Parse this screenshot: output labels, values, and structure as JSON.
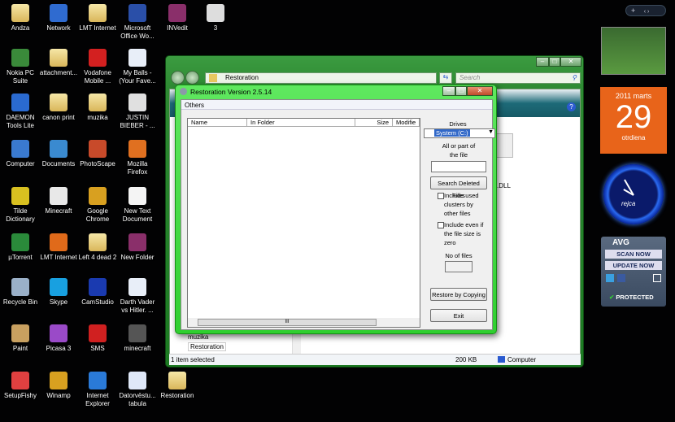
{
  "desktop": {
    "icons": [
      {
        "label": "Andza",
        "icon": "folder-icon",
        "color": "folder"
      },
      {
        "label": "Network",
        "icon": "network-icon",
        "color": "#2f6bd0"
      },
      {
        "label": "LMT Internet",
        "icon": "folder-icon",
        "color": "folder"
      },
      {
        "label": "Microsoft Office Wo...",
        "icon": "word-icon",
        "color": "#2a4fa8"
      },
      {
        "label": "INVedit",
        "icon": "winrar-icon",
        "color": "#8a2f6a"
      },
      {
        "label": "3",
        "icon": "calendar-icon",
        "color": "#dddddd"
      },
      {
        "label": "Nokia PC Suite",
        "icon": "nokia-icon",
        "color": "#3a8a3a"
      },
      {
        "label": "attachment...",
        "icon": "folder-icon",
        "color": "folder"
      },
      {
        "label": "Vodafone Mobile ...",
        "icon": "vodafone-icon",
        "color": "#d32020"
      },
      {
        "label": "My Balls - (Your Fave...",
        "icon": "audio-file-icon",
        "color": "#e8eef8"
      },
      {
        "label": "DAEMON Tools Lite",
        "icon": "daemon-icon",
        "color": "#2a6ad0"
      },
      {
        "label": "canon print",
        "icon": "folder-icon",
        "color": "folder"
      },
      {
        "label": "muzika",
        "icon": "folder-icon",
        "color": "folder"
      },
      {
        "label": "JUSTIN BIEBER - ...",
        "icon": "video-file-icon",
        "color": "#e0e0e0"
      },
      {
        "label": "Computer",
        "icon": "computer-icon",
        "color": "#3a7ad0"
      },
      {
        "label": "Documents",
        "icon": "documents-icon",
        "color": "#3a8ad0"
      },
      {
        "label": "PhotoScape",
        "icon": "photoscape-icon",
        "color": "#c84a2a"
      },
      {
        "label": "Mozilla Firefox",
        "icon": "firefox-icon",
        "color": "#e07020"
      },
      {
        "label": "Tilde Dictionary",
        "icon": "tilde-icon",
        "color": "#d8c020"
      },
      {
        "label": "Minecraft",
        "icon": "file-icon",
        "color": "#e8e8e8"
      },
      {
        "label": "Google Chrome",
        "icon": "chrome-icon",
        "color": "#d8a020"
      },
      {
        "label": "New Text Document",
        "icon": "text-file-icon",
        "color": "#f4f4f4"
      },
      {
        "label": "µTorrent",
        "icon": "utorrent-icon",
        "color": "#2a8a3a"
      },
      {
        "label": "LMT Internet",
        "icon": "lmt-icon",
        "color": "#e06a1a"
      },
      {
        "label": "Left 4 dead 2",
        "icon": "folder-icon",
        "color": "folder"
      },
      {
        "label": "New Folder",
        "icon": "winrar-icon",
        "color": "#8a2f6a"
      },
      {
        "label": "Recycle Bin",
        "icon": "recycle-bin-icon",
        "color": "#9ab0c8"
      },
      {
        "label": "Skype",
        "icon": "skype-icon",
        "color": "#18a0e0"
      },
      {
        "label": "CamStudio",
        "icon": "camstudio-icon",
        "color": "#1a3ab0"
      },
      {
        "label": "Darth Vader vs Hitler. ...",
        "icon": "audio-file-icon",
        "color": "#e8eef8"
      },
      {
        "label": "Paint",
        "icon": "paint-icon",
        "color": "#c8a060"
      },
      {
        "label": "Picasa 3",
        "icon": "picasa-icon",
        "color": "#9a4ac8"
      },
      {
        "label": "SMS",
        "icon": "sms-icon",
        "color": "#d02020"
      },
      {
        "label": "minecraft",
        "icon": "chip-icon",
        "color": "#555555"
      },
      {
        "label": "SetupFishy",
        "icon": "fish-icon",
        "color": "#e04040"
      },
      {
        "label": "Winamp",
        "icon": "winamp-icon",
        "color": "#d8a020"
      },
      {
        "label": "Internet Explorer",
        "icon": "ie-icon",
        "color": "#2a7ad8"
      },
      {
        "label": "Datorvēstu... tabula",
        "icon": "word-doc-icon",
        "color": "#dfe8f8"
      },
      {
        "label": "Restoration",
        "icon": "folder-icon",
        "color": "folder"
      }
    ]
  },
  "explorer": {
    "address": "Restoration",
    "search_placeholder": "Search",
    "status_left": "1 item selected",
    "status_size": "200 KB",
    "status_location": "Computer",
    "tree_items": [
      "muzika",
      "Restoration"
    ],
    "file_label": ".DLL"
  },
  "dialog": {
    "title": "Restoration Version 2.5.14",
    "menu": "Others",
    "columns": [
      "Name",
      "In Folder",
      "Size",
      "Modifie"
    ],
    "drives_label": "Drives",
    "drive_value": "System (C:)",
    "filename_label": "All or part of the file",
    "filename_value": "",
    "search_button": "Search Deleted Files",
    "checkbox1": "Include used clusters by other files",
    "checkbox1_checked": false,
    "checkbox2": "Include even if the file size is zero",
    "checkbox2_checked": false,
    "nofiles_label": "No of files",
    "nofiles_value": "",
    "restore_button": "Restore by Copying",
    "exit_button": "Exit"
  },
  "gadgets": {
    "calendar": {
      "month": "2011 marts",
      "day": "29",
      "weekday": "otrdiena"
    },
    "clock_brand": "rejca",
    "avg": {
      "brand": "AVG",
      "scan": "SCAN NOW",
      "update": "UPDATE NOW",
      "status": "PROTECTED"
    }
  },
  "colors": {
    "window_frame": "#2e8a33",
    "dialog_frame": "#3fd83f",
    "calendar": "#e8641a",
    "clock": "#1a4ad8"
  }
}
